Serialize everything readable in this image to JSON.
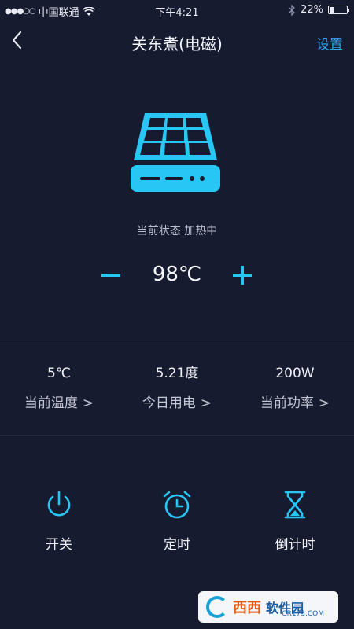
{
  "status_bar": {
    "signal": "●●●○○",
    "carrier": "中国联通",
    "time": "下午4:21",
    "battery": "22%",
    "battery_level": 0.22
  },
  "nav": {
    "title": "关东煮(电磁)",
    "settings_label": "设置"
  },
  "device": {
    "status_text": "当前状态 加热中",
    "set_temperature": "98℃"
  },
  "stats": [
    {
      "value": "5℃",
      "label": "当前温度"
    },
    {
      "value": "5.21度",
      "label": "今日用电"
    },
    {
      "value": "200W",
      "label": "当前功率"
    }
  ],
  "actions": [
    {
      "label": "开关",
      "icon": "power-icon"
    },
    {
      "label": "定时",
      "icon": "alarm-clock-icon"
    },
    {
      "label": "倒计时",
      "icon": "hourglass-icon"
    }
  ],
  "watermark": {
    "text": "西西",
    "brand": "软件园",
    "url": "CR173.COM"
  },
  "colors": {
    "background": "#171b30",
    "accent": "#2ea8ee",
    "icon_cyan": "#27c6f4"
  }
}
